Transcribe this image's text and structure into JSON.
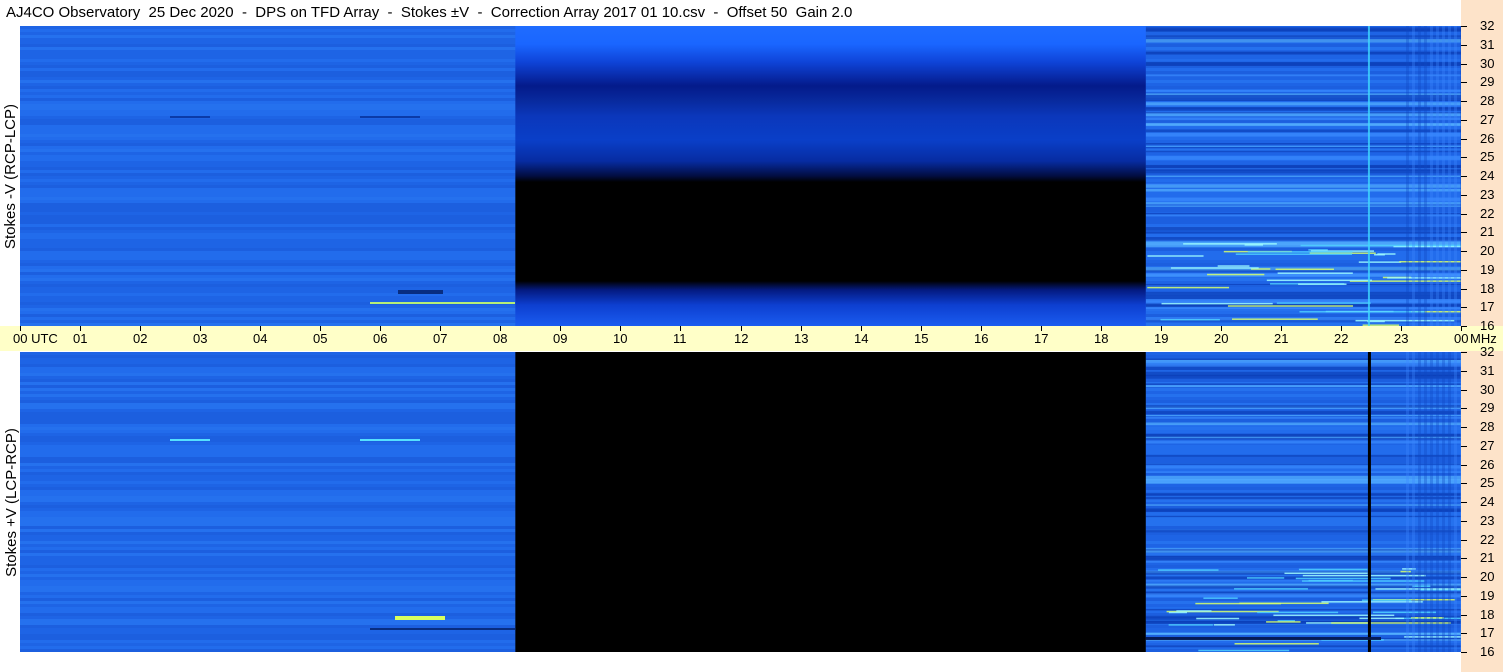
{
  "title": "AJ4CO Observatory  25 Dec 2020  -  DPS on TFD Array  -  Stokes ±V  -  Correction Array 2017 01 10.csv  -  Offset 50  Gain 2.0",
  "chart_data": {
    "type": "heatmap",
    "title": "AJ4CO Observatory  25 Dec 2020  -  DPS on TFD Array  -  Stokes ±V  -  Correction Array 2017 01 10.csv  -  Offset 50  Gain 2.0",
    "xlabel": "UTC",
    "x_ticks": [
      "00 UTC",
      "01",
      "02",
      "03",
      "04",
      "05",
      "06",
      "07",
      "08",
      "09",
      "10",
      "11",
      "12",
      "13",
      "14",
      "15",
      "16",
      "17",
      "18",
      "19",
      "20",
      "21",
      "22",
      "23",
      "00"
    ],
    "xlim": [
      0,
      24
    ],
    "y_unit": "MHz",
    "y_ticks": [
      "32",
      "31",
      "30",
      "29",
      "28",
      "27",
      "26",
      "25",
      "24",
      "23",
      "22",
      "21",
      "20",
      "19",
      "18",
      "17",
      "16"
    ],
    "ylim": [
      16,
      32
    ],
    "panels": [
      {
        "ylabel": "Stokes -V (RCP-LCP)"
      },
      {
        "ylabel": "Stokes +V (LCP-RCP)"
      }
    ],
    "data_gap_utc": [
      8.25,
      18.75
    ],
    "colors": {
      "background_blue": "#1e64e6",
      "gap": "#000000",
      "axis_strip": "#ffffc8",
      "freq_strip": "#fde3c9"
    }
  }
}
